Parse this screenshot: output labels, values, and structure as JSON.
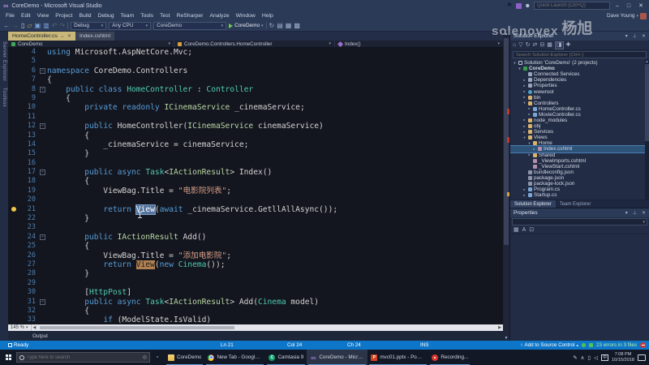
{
  "colors": {
    "accent_blue": "#0e76c9",
    "active_tab": "#c9b879",
    "selection": "#56759e",
    "usage_highlight": "#b08050",
    "keyword": "#569cd6",
    "type": "#4ec9b0",
    "interface": "#b8d7a3",
    "string": "#d69d85"
  },
  "window": {
    "title": "CoreDemo - Microsoft Visual Studio",
    "quick_launch_placeholder": "Quick Launch (Ctrl+Q)",
    "user_name": "Dave Young"
  },
  "menu": {
    "items": [
      "File",
      "Edit",
      "View",
      "Project",
      "Build",
      "Debug",
      "Team",
      "Tools",
      "Test",
      "ReSharper",
      "Analyze",
      "Window",
      "Help"
    ]
  },
  "toolbar": {
    "left_icons": [
      "navigate-back",
      "navigate-forward",
      "new-file",
      "open-file",
      "save",
      "save-all",
      "undo",
      "redo"
    ],
    "config": "Debug",
    "platform": "Any CPU",
    "project": "CoreDemo",
    "run_label": "CoreDemo",
    "right_icons": [
      "refresh",
      "build-selection",
      "list-members",
      "word-wrap"
    ]
  },
  "watermark": {
    "text": "solenovex",
    "cjk": "杨旭"
  },
  "side_tabs": [
    "Server Explorer",
    "Toolbox"
  ],
  "document_tabs": [
    {
      "label": "HomeController.cs",
      "active": true
    },
    {
      "label": "Index.cshtml",
      "active": false
    }
  ],
  "navbar": {
    "project": "CoreDemo",
    "type": "CoreDemo.Controllers.HomeController",
    "member": "Index()"
  },
  "editor": {
    "zoom": "145 %",
    "lines": [
      {
        "n": 4,
        "t": [
          [
            "k",
            "using"
          ],
          [
            "p",
            " Microsoft.AspNetCore.Mvc;"
          ]
        ]
      },
      {
        "n": 5,
        "t": []
      },
      {
        "n": 6,
        "fold": true,
        "t": [
          [
            "k",
            "namespace"
          ],
          [
            "p",
            " CoreDemo.Controllers"
          ]
        ]
      },
      {
        "n": 7,
        "t": [
          [
            "p",
            "{"
          ]
        ]
      },
      {
        "n": 8,
        "fold": true,
        "t": [
          [
            "p",
            "    "
          ],
          [
            "k",
            "public"
          ],
          [
            "p",
            " "
          ],
          [
            "k",
            "class"
          ],
          [
            "p",
            " "
          ],
          [
            "t",
            "HomeController"
          ],
          [
            "p",
            " : "
          ],
          [
            "t",
            "Controller"
          ]
        ]
      },
      {
        "n": 9,
        "t": [
          [
            "p",
            "    {"
          ]
        ]
      },
      {
        "n": 10,
        "t": [
          [
            "p",
            "        "
          ],
          [
            "k",
            "private"
          ],
          [
            "p",
            " "
          ],
          [
            "k",
            "readonly"
          ],
          [
            "p",
            " "
          ],
          [
            "i",
            "ICinemaService"
          ],
          [
            "p",
            " _cinemaService;"
          ]
        ]
      },
      {
        "n": 11,
        "t": []
      },
      {
        "n": 12,
        "fold": true,
        "t": [
          [
            "p",
            "        "
          ],
          [
            "k",
            "public"
          ],
          [
            "p",
            " HomeController("
          ],
          [
            "i",
            "ICinemaService"
          ],
          [
            "p",
            " cinemaService)"
          ]
        ]
      },
      {
        "n": 13,
        "t": [
          [
            "p",
            "        {"
          ]
        ]
      },
      {
        "n": 14,
        "t": [
          [
            "p",
            "            _cinemaService = cinemaService;"
          ]
        ]
      },
      {
        "n": 15,
        "t": [
          [
            "p",
            "        }"
          ]
        ]
      },
      {
        "n": 16,
        "t": []
      },
      {
        "n": 17,
        "fold": true,
        "t": [
          [
            "p",
            "        "
          ],
          [
            "k",
            "public"
          ],
          [
            "p",
            " "
          ],
          [
            "k",
            "async"
          ],
          [
            "p",
            " "
          ],
          [
            "t",
            "Task"
          ],
          [
            "p",
            "<"
          ],
          [
            "i",
            "IActionResult"
          ],
          [
            "p",
            "> Index()"
          ]
        ]
      },
      {
        "n": 18,
        "t": [
          [
            "p",
            "        {"
          ]
        ]
      },
      {
        "n": 19,
        "t": [
          [
            "p",
            "            ViewBag.Title = "
          ],
          [
            "s",
            "\"电影院列表\""
          ],
          [
            "p",
            ";"
          ]
        ]
      },
      {
        "n": 20,
        "t": []
      },
      {
        "n": 21,
        "bulb": true,
        "t": [
          [
            "p",
            "            "
          ],
          [
            "k",
            "return"
          ],
          [
            "p",
            " "
          ],
          [
            "vsel",
            "View"
          ],
          [
            "p",
            "("
          ],
          [
            "k",
            "await"
          ],
          [
            "p",
            " _cinemaService.GetllAllAsync());"
          ]
        ]
      },
      {
        "n": 22,
        "t": [
          [
            "p",
            "        }"
          ]
        ]
      },
      {
        "n": 23,
        "t": []
      },
      {
        "n": 24,
        "fold": true,
        "t": [
          [
            "p",
            "        "
          ],
          [
            "k",
            "public"
          ],
          [
            "p",
            " "
          ],
          [
            "i",
            "IActionResult"
          ],
          [
            "p",
            " Add()"
          ]
        ]
      },
      {
        "n": 25,
        "t": [
          [
            "p",
            "        {"
          ]
        ]
      },
      {
        "n": 26,
        "t": [
          [
            "p",
            "            ViewBag.Title = "
          ],
          [
            "s",
            "\"添加电影院\""
          ],
          [
            "p",
            ";"
          ]
        ]
      },
      {
        "n": 27,
        "t": [
          [
            "p",
            "            "
          ],
          [
            "k",
            "return"
          ],
          [
            "p",
            " "
          ],
          [
            "vhl",
            "View"
          ],
          [
            "p",
            "("
          ],
          [
            "k",
            "new"
          ],
          [
            "p",
            " "
          ],
          [
            "t",
            "Cinema"
          ],
          [
            "p",
            "());"
          ]
        ]
      },
      {
        "n": 28,
        "t": [
          [
            "p",
            "        }"
          ]
        ]
      },
      {
        "n": 29,
        "t": []
      },
      {
        "n": 30,
        "t": [
          [
            "p",
            "        ["
          ],
          [
            "t",
            "HttpPost"
          ],
          [
            "p",
            "]"
          ]
        ]
      },
      {
        "n": 31,
        "fold": true,
        "t": [
          [
            "p",
            "        "
          ],
          [
            "k",
            "public"
          ],
          [
            "p",
            " "
          ],
          [
            "k",
            "async"
          ],
          [
            "p",
            " "
          ],
          [
            "t",
            "Task"
          ],
          [
            "p",
            "<"
          ],
          [
            "i",
            "IActionResult"
          ],
          [
            "p",
            "> Add("
          ],
          [
            "t",
            "Cinema"
          ],
          [
            "p",
            " model)"
          ]
        ]
      },
      {
        "n": 32,
        "t": [
          [
            "p",
            "        {"
          ]
        ]
      },
      {
        "n": 33,
        "t": [
          [
            "p",
            "            "
          ],
          [
            "k",
            "if"
          ],
          [
            "p",
            " (ModelState.IsValid)"
          ]
        ]
      }
    ]
  },
  "output": {
    "label": "Output"
  },
  "status": {
    "ready": "Ready",
    "line": "Ln 21",
    "col": "Col 24",
    "ch": "Ch 24",
    "mode": "INS",
    "source_control": "Add to Source Control",
    "analysis": "23 errors in 3 files"
  },
  "solution_explorer": {
    "title": "Solution Explorer",
    "search_placeholder": "Search Solution Explorer (Ctrl+;)",
    "toolbar_icons": [
      "home",
      "filter",
      "sync",
      "scope",
      "collapse-all",
      "show-all-files",
      "preview-selected",
      "properties"
    ],
    "tree": [
      {
        "l": "Solution 'CoreDemo' (2 projects)",
        "i": "solution",
        "d": 0,
        "e": "o"
      },
      {
        "l": "CoreDemo",
        "i": "csproj",
        "d": 1,
        "e": "o",
        "b": true
      },
      {
        "l": "Connected Services",
        "i": "plug",
        "d": 2
      },
      {
        "l": "Dependencies",
        "i": "deps",
        "d": 2,
        "e": "c"
      },
      {
        "l": "Properties",
        "i": "wrench",
        "d": 2,
        "e": "c"
      },
      {
        "l": "wwwroot",
        "i": "globe",
        "d": 2,
        "e": "c"
      },
      {
        "l": "bin",
        "i": "folder",
        "d": 2,
        "e": "c"
      },
      {
        "l": "Controllers",
        "i": "folder",
        "d": 2,
        "e": "o"
      },
      {
        "l": "HomeController.cs",
        "i": "cs",
        "d": 3,
        "e": "c"
      },
      {
        "l": "MovieController.cs",
        "i": "cs",
        "d": 3,
        "e": "c"
      },
      {
        "l": "node_modules",
        "i": "folder",
        "d": 2,
        "e": "c"
      },
      {
        "l": "obj",
        "i": "folder",
        "d": 2,
        "e": "c"
      },
      {
        "l": "Services",
        "i": "folder",
        "d": 2,
        "e": "c"
      },
      {
        "l": "Views",
        "i": "folder",
        "d": 2,
        "e": "o"
      },
      {
        "l": "Home",
        "i": "folder",
        "d": 3,
        "e": "o"
      },
      {
        "l": "Index.cshtml",
        "i": "razor",
        "d": 4,
        "e": "c",
        "s": true
      },
      {
        "l": "Shared",
        "i": "folder",
        "d": 3,
        "e": "c"
      },
      {
        "l": "_ViewImports.cshtml",
        "i": "razor",
        "d": 3
      },
      {
        "l": "_ViewStart.cshtml",
        "i": "razor",
        "d": 3
      },
      {
        "l": "bundleconfig.json",
        "i": "json",
        "d": 2
      },
      {
        "l": "package.json",
        "i": "json",
        "d": 2
      },
      {
        "l": "package-lock.json",
        "i": "json",
        "d": 2
      },
      {
        "l": "Program.cs",
        "i": "cs",
        "d": 2,
        "e": "c"
      },
      {
        "l": "Startup.cs",
        "i": "cs",
        "d": 2,
        "e": "c"
      }
    ],
    "bottom_tabs": [
      {
        "label": "Solution Explorer",
        "active": true
      },
      {
        "label": "Team Explorer",
        "active": false
      }
    ]
  },
  "properties_panel": {
    "title": "Properties",
    "toolbar_icons": [
      "categorized",
      "alphabetical",
      "property-pages"
    ]
  },
  "taskbar": {
    "search_placeholder": "Type here to search",
    "apps": [
      {
        "label": "CoreDemo",
        "icon": "folder-explorer"
      },
      {
        "label": "New Tab - Google ...",
        "icon": "chrome"
      },
      {
        "label": "Camtasia 9",
        "icon": "camtasia"
      },
      {
        "label": "CoreDemo - Micro...",
        "icon": "visual-studio",
        "active": true
      },
      {
        "label": "mvc01.pptx - Powe...",
        "icon": "powerpoint"
      },
      {
        "label": "Recording...",
        "icon": "recorder"
      }
    ],
    "tray_icons": [
      "pen",
      "hidden-icons",
      "battery",
      "volume"
    ],
    "ime_label": "中",
    "time": "7:08 PM",
    "date": "10/15/2018"
  }
}
